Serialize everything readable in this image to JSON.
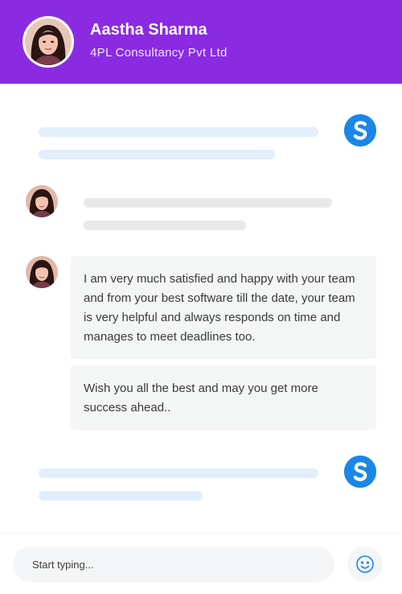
{
  "header": {
    "name": "Aastha Sharma",
    "company": "4PL Consultancy Pvt Ltd"
  },
  "messages": [
    "I am very much satisfied and happy with your team and from your best software till the date, your team is very helpful and always responds on time and manages to meet deadlines too.",
    "Wish you all the best and may you get more success ahead.."
  ],
  "composer": {
    "placeholder": "Start typing..."
  },
  "icons": {
    "agent_logo": "s-logo-icon",
    "emoji": "smiley-icon"
  },
  "colors": {
    "header_bg": "#8a2be2",
    "agent_logo": "#1a86e8",
    "skeleton_agent": "#e3eefb",
    "skeleton_user": "#e9e9ea",
    "bubble_bg": "#f4f5f5"
  }
}
